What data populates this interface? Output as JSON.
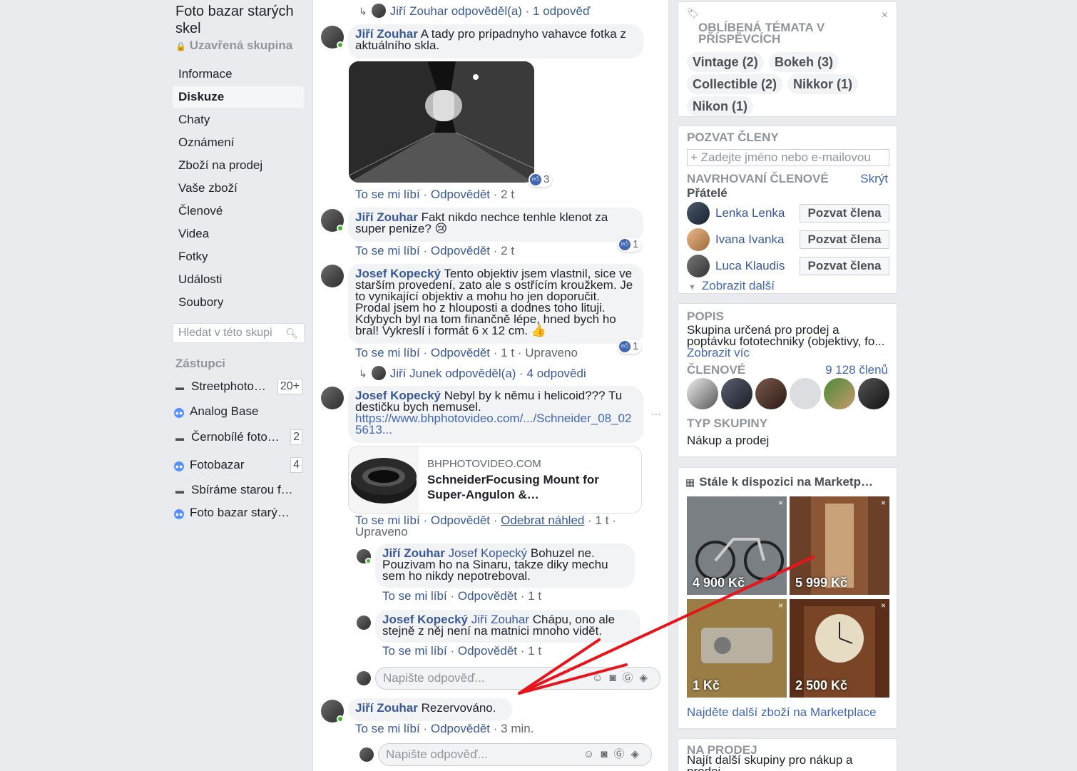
{
  "group": {
    "title": "Foto bazar starých skel",
    "privacy": "Uzavřená skupina"
  },
  "nav": [
    "Informace",
    "Diskuze",
    "Chaty",
    "Oznámení",
    "Zboží na prodej",
    "Vaše zboží",
    "Členové",
    "Videa",
    "Fotky",
    "Události",
    "Soubory"
  ],
  "search_placeholder": "Hledat v této skupi",
  "shortcuts": {
    "title": "Zástupci",
    "items": [
      {
        "name": "Streetphoto…",
        "count": "20+",
        "icon": "page-icon"
      },
      {
        "name": "Analog Base",
        "count": "",
        "icon": "group-icon"
      },
      {
        "name": "Černobílé foto…",
        "count": "2",
        "icon": "page-icon"
      },
      {
        "name": "Fotobazar",
        "count": "4",
        "icon": "group-icon"
      },
      {
        "name": "Sbíráme starou f…",
        "count": "",
        "icon": "page-icon"
      },
      {
        "name": "Foto bazar starý…",
        "count": "",
        "icon": "group-icon"
      }
    ]
  },
  "actions": {
    "like": "To se mi líbí",
    "reply": "Odpovědět",
    "remove_preview": "Odebrat náhled",
    "edited": "Upraveno"
  },
  "thread": {
    "top_reply_link": {
      "text": "Jiří Zouhar odpověděl(a) · 1 odpověď"
    },
    "c1": {
      "author": "Jiří Zouhar",
      "text": "A tady pro pripadnyho vahavce fotka z aktuálního skla.",
      "time": "2 t",
      "reactions": "3"
    },
    "c2": {
      "author": "Jiří Zouhar",
      "text": "Fakt nikdo nechce tenhle klenot za super penize? 😢",
      "time": "2 t",
      "reactions": "1"
    },
    "c3": {
      "author": "Josef Kopecký",
      "text": "Tento objektiv jsem vlastnil, sice ve starším provedení, zato ale s ostřícím kroužkem. Je to vynikající objektiv a mohu ho jen doporučit. Prodal jsem ho z hlouposti a dodnes toho lituji. Kdybych byl na tom finančně lépe, hned bych ho bral! Vykreslí i formát 6 x 12 cm. 👍",
      "time": "1 t",
      "reactions": "1",
      "reply_link": "Jiří Junek odpověděl(a) · 4 odpovědi"
    },
    "c4": {
      "author": "Josef Kopecký",
      "text": "Nebyl by k němu i helicoid??? Tu destičku bych nemusel.",
      "url": "https://www.bhphotovideo.com/.../Schneider_08_025613...",
      "time": "1 t"
    },
    "link_preview": {
      "domain": "BHPHOTOVIDEO.COM",
      "title": "SchneiderFocusing Mount for Super-Angulon &…"
    },
    "r1": {
      "author": "Jiří Zouhar",
      "mention": "Josef Kopecký",
      "text": "Bohuzel ne. Pouzivam ho na Sinaru, takze diky mechu sem ho nikdy nepotreboval.",
      "time": "1 t"
    },
    "r2": {
      "author": "Josef Kopecký",
      "mention": "Jiří Zouhar",
      "text": "Chápu, ono ale stejně z něj není na matnici mnoho vidět.",
      "time": "1 t"
    },
    "reply_placeholder": "Napište odpověď...",
    "c5": {
      "author": "Jiří Zouhar",
      "text": "Rezervováno.",
      "time": "3 min."
    }
  },
  "topics": {
    "title": "Oblíbená témata v příspěvcích",
    "chips": [
      "Vintage (2)",
      "Bokeh (3)",
      "Collectible (2)",
      "Nikkor (1)",
      "Nikon (1)"
    ]
  },
  "invite": {
    "title": "Pozvat členy",
    "placeholder": "+ Zadejte jméno nebo e-mailovou",
    "suggested_title": "Navrhovaní členové",
    "hide": "Skrýt",
    "friends": "Přátelé",
    "people": [
      "Lenka Lenka",
      "Ivana Ivanka",
      "Luca Klaudis"
    ],
    "invite_btn": "Pozvat člena",
    "show_more": "Zobrazit další"
  },
  "about": {
    "title": "Popis",
    "text": "Skupina určená pro prodej a poptávku fototechniky (objektivy, fo...",
    "see_more": "Zobrazit víc",
    "members_title": "Členové",
    "members_count": "9 128 členů",
    "type_title": "Typ skupiny",
    "type": "Nákup a prodej"
  },
  "marketplace": {
    "title": "Stále k dispozici na Marketp…",
    "prices": [
      "4 900 Kč",
      "5 999 Kč",
      "1 Kč",
      "2 500 Kč"
    ],
    "footer": "Najděte další zboží na Marketplace"
  },
  "forsale": {
    "title": "Na prodej",
    "text": "Najít další skupiny pro nákup a prodej"
  },
  "colors": {
    "link": "#385898",
    "accent": "#4267b2",
    "annotation_arrow": "#e8141b"
  }
}
